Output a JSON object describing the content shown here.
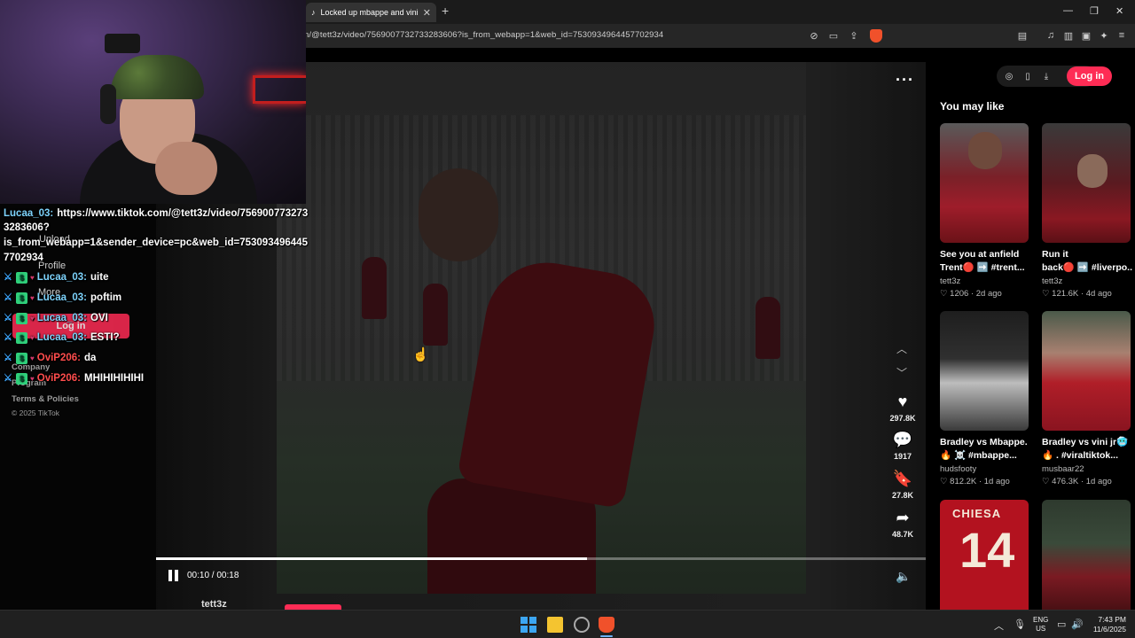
{
  "browser": {
    "tab_title": "Locked up mbappe and vini🟥",
    "url": "n/@tett3z/video/7569007732733283606?is_from_webapp=1&web_id=7530934964457702934"
  },
  "tiktok": {
    "left_nav": {
      "items": [
        "Upload",
        "Profile",
        "More"
      ],
      "login_label": "Log in",
      "footer": [
        "Company",
        "Program",
        "Terms & Policies",
        "© 2025 TikTok"
      ]
    },
    "video": {
      "likes": "297.8K",
      "comments": "1917",
      "saves": "27.8K",
      "shares": "48.7K",
      "time": "00:10 / 00:18",
      "progress_fraction": 0.56,
      "author": "tett3z"
    },
    "header": {
      "login_label": "Log in"
    },
    "you_may_like": "You may like",
    "recommended": [
      {
        "title": "See you at anfield",
        "subtitle": "Trent🔴 ➡️ #trent...",
        "author": "tett3z",
        "likes": "1206",
        "age": "2d ago"
      },
      {
        "title": "Run it",
        "subtitle": "back🔴 ➡️ #liverpo...",
        "author": "tett3z",
        "likes": "121.6K",
        "age": "4d ago"
      },
      {
        "title": "Bradley vs Mbappe.",
        "subtitle": "🔥 ☠️ #mbappe...",
        "author": "hudsfooty",
        "likes": "812.2K",
        "age": "1d ago"
      },
      {
        "title": "Bradley vs vini jr🥶",
        "subtitle": "🔥 . #viraltiktok...",
        "author": "musbaar22",
        "likes": "476.3K",
        "age": "1d ago"
      },
      {
        "title": "",
        "subtitle": "",
        "author": "",
        "likes": "",
        "age": ""
      },
      {
        "title": "",
        "subtitle": "",
        "author": "",
        "likes": "",
        "age": ""
      }
    ]
  },
  "chat": [
    {
      "user": "Lucaa_03:",
      "text": "https://www.tiktok.com/@tett3z/video/756900773273",
      "color": "blue"
    },
    {
      "user": "",
      "text": "3283606?",
      "color": ""
    },
    {
      "user": "",
      "text": "is_from_webapp=1&sender_device=pc&web_id=753093496445",
      "color": ""
    },
    {
      "user": "",
      "text": "7702934",
      "color": ""
    },
    {
      "user": "Lucaa_03:",
      "text": "uite",
      "color": "blue"
    },
    {
      "user": "Lucaa_03:",
      "text": "poftim",
      "color": "blue"
    },
    {
      "user": "Lucaa_03:",
      "text": "OVI",
      "color": "blue"
    },
    {
      "user": "Lucaa_03:",
      "text": "ESTI?",
      "color": "blue"
    },
    {
      "user": "OviP206:",
      "text": "da",
      "color": "red"
    },
    {
      "user": "OviP206:",
      "text": "MHIHIHIHIHI",
      "color": "red"
    }
  ],
  "taskbar": {
    "lang_top": "ENG",
    "lang_bottom": "US",
    "time": "7:43 PM",
    "date": "11/6/2025"
  },
  "colors": {
    "accent": "#fe2c55",
    "chat_user_blue": "#7dd3fc",
    "chat_user_red": "#ff4d4d"
  }
}
